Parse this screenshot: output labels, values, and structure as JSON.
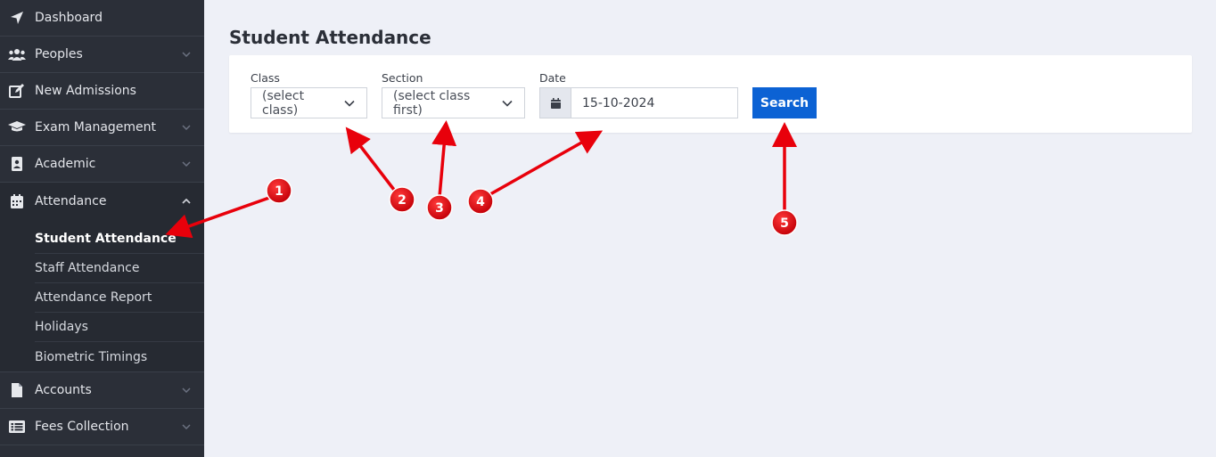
{
  "sidebar": {
    "items": [
      {
        "label": "Dashboard",
        "icon": "location-arrow-icon"
      },
      {
        "label": "Peoples",
        "icon": "users-icon"
      },
      {
        "label": "New Admissions",
        "icon": "edit-icon"
      },
      {
        "label": "Exam Management",
        "icon": "graduation-cap-icon"
      },
      {
        "label": "Academic",
        "icon": "address-book-icon"
      },
      {
        "label": "Attendance",
        "icon": "calendar-icon"
      },
      {
        "label": "Accounts",
        "icon": "file-icon"
      },
      {
        "label": "Fees Collection",
        "icon": "list-alt-icon"
      }
    ],
    "attendance_submenu": [
      {
        "label": "Student Attendance"
      },
      {
        "label": "Staff Attendance"
      },
      {
        "label": "Attendance Report"
      },
      {
        "label": "Holidays"
      },
      {
        "label": "Biometric Timings"
      }
    ]
  },
  "main": {
    "page_title": "Student Attendance",
    "filters": {
      "class_label": "Class",
      "class_value": "(select class)",
      "section_label": "Section",
      "section_value": "(select class first)",
      "date_label": "Date",
      "date_value": "15-10-2024",
      "search_label": "Search"
    }
  },
  "annotations": {
    "color": "#e8000b",
    "badges": [
      "1",
      "2",
      "3",
      "4",
      "5"
    ]
  },
  "colors": {
    "sidebar_bg": "#2b2f38",
    "page_bg": "#eef0f7",
    "primary": "#0c62d4"
  }
}
